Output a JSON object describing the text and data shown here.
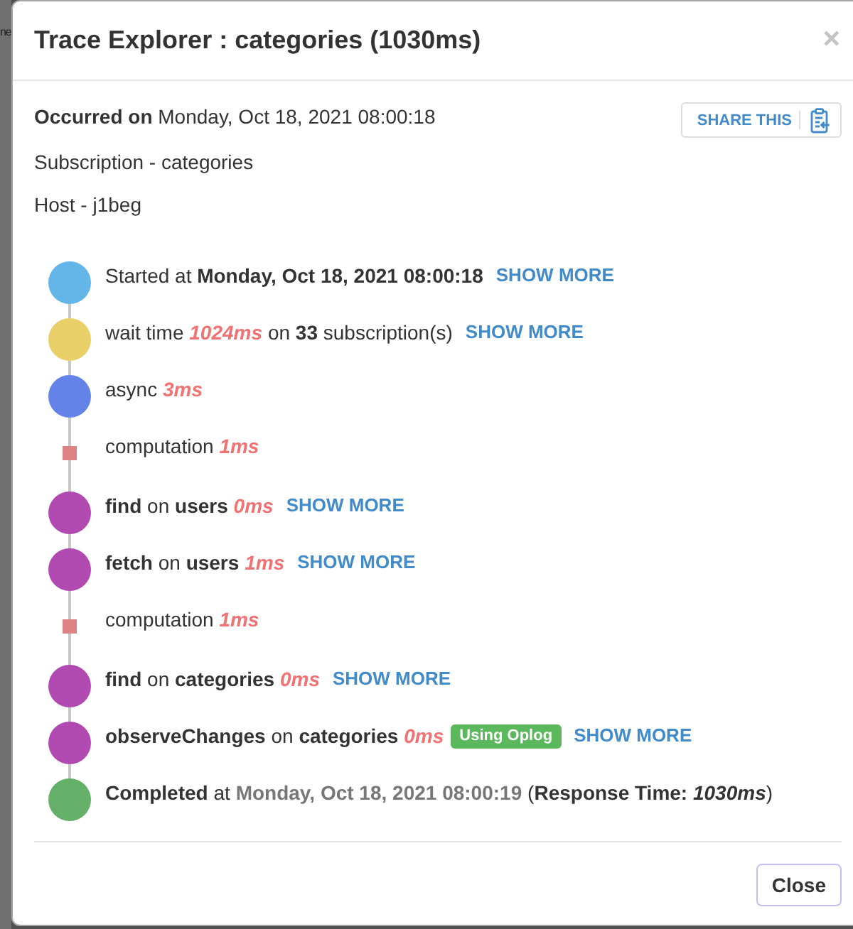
{
  "backdrop": {
    "text": "ne"
  },
  "modal": {
    "title": "Trace Explorer : categories (1030ms)",
    "close_symbol": "×"
  },
  "details": {
    "occurred": "**Occurred on** Monday, Oct 18, 2021 08:00:18",
    "lines": [
      "Subscription - categories",
      "Host - j1beg"
    ]
  },
  "share_button": {
    "label": "SHARE THIS"
  },
  "timeline": [
    {
      "kind": "event",
      "color": "#64b6e9",
      "text": "Started at **Monday, Oct 18, 2021 08:00:18**",
      "action": "SHOW MORE"
    },
    {
      "kind": "event",
      "color": "#e9cf68",
      "text": "wait time",
      "duration": "1024ms",
      "after": "on **33** subscription(s)",
      "action": "SHOW MORE"
    },
    {
      "kind": "event",
      "color": "#6383e9",
      "text": "async",
      "duration": "3ms"
    },
    {
      "kind": "step",
      "color": "#dd8282",
      "text": "computation",
      "duration": "1ms"
    },
    {
      "kind": "event",
      "color": "#b04ab0",
      "text": "**find** on **users**",
      "duration": "0ms",
      "action": "SHOW MORE"
    },
    {
      "kind": "event",
      "color": "#b04ab0",
      "text": "**fetch** on **users**",
      "duration": "1ms",
      "action": "SHOW MORE"
    },
    {
      "kind": "step",
      "color": "#dd8282",
      "text": "computation",
      "duration": "1ms"
    },
    {
      "kind": "event",
      "color": "#b04ab0",
      "text": "**find** on **categories**",
      "duration": "0ms",
      "action": "SHOW MORE"
    },
    {
      "kind": "event",
      "color": "#b04ab0",
      "text": "**observeChanges** on **categories**",
      "duration": "0ms",
      "badge": "Using Oplog",
      "action": "SHOW MORE"
    },
    {
      "kind": "event",
      "color": "#64b068",
      "text": "**Completed** at",
      "timestamp": "Monday, Oct 18, 2021 08:00:19",
      "after": "(**Response Time:** *1030ms*)"
    }
  ],
  "footer": {
    "close_button": {
      "label": "Close",
      "focused": true
    }
  }
}
